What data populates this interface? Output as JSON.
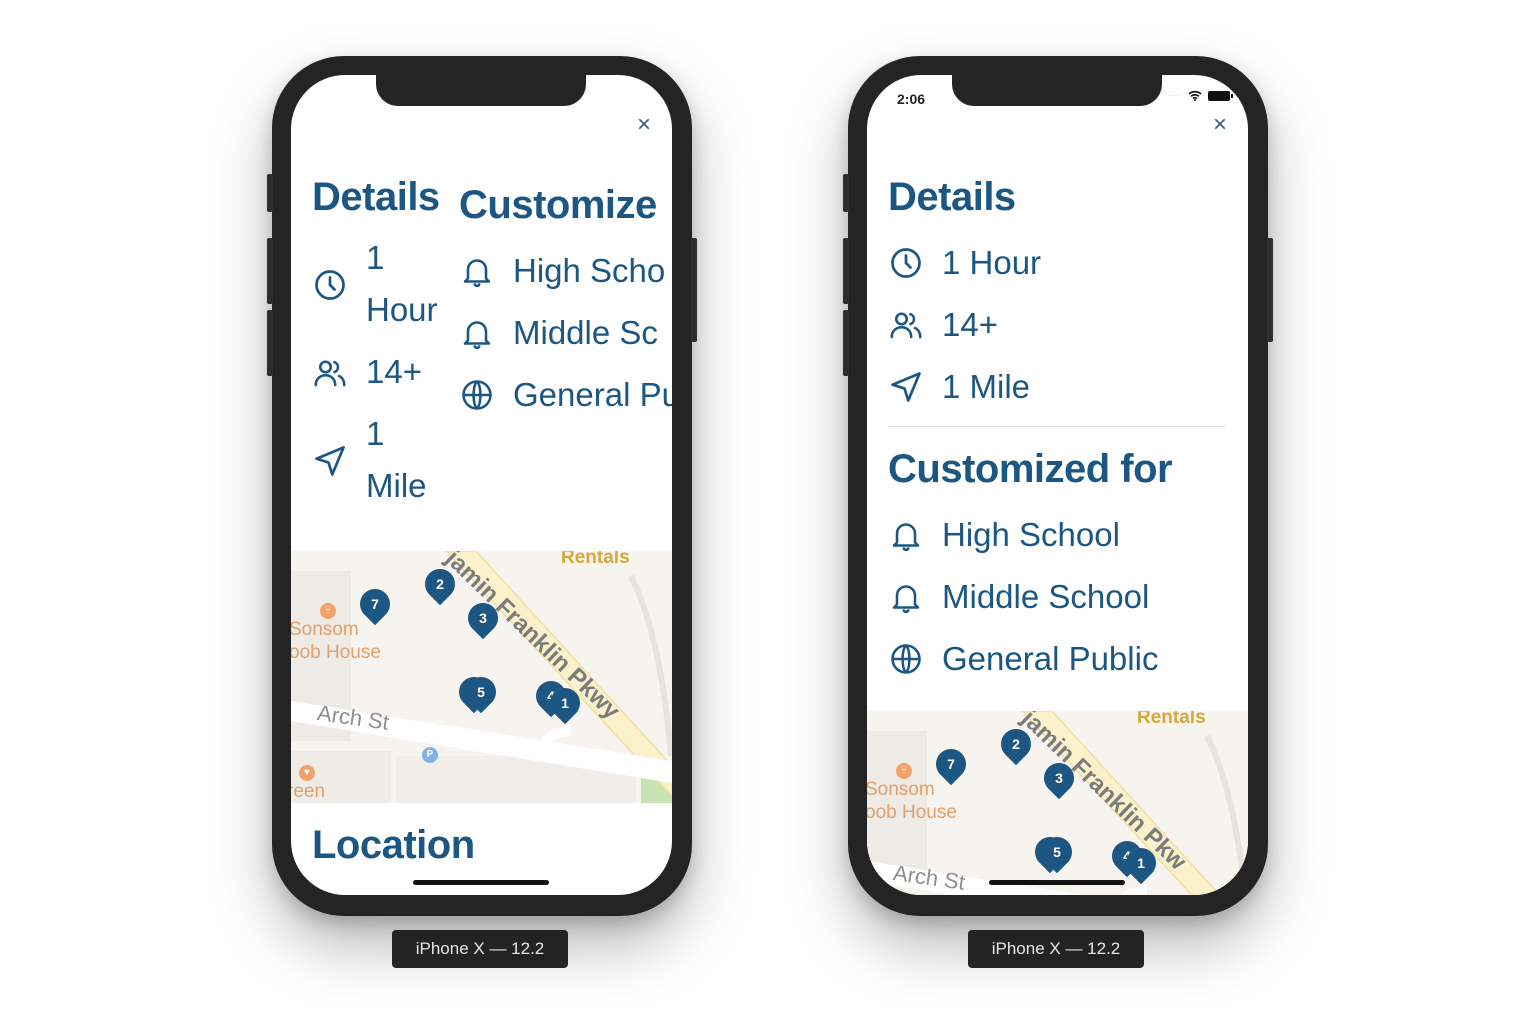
{
  "devices": [
    {
      "label": "iPhone X — 12.2",
      "status_bar": null,
      "close_icon": "×",
      "details": {
        "heading": "Details",
        "items": [
          {
            "icon": "clock-icon",
            "text": "1 Hour",
            "lines": [
              "1",
              "Hour"
            ]
          },
          {
            "icon": "people-icon",
            "text": "14+",
            "lines": [
              "14+"
            ]
          },
          {
            "icon": "location-arrow-icon",
            "text": "1 Mile",
            "lines": [
              "1",
              "Mile"
            ]
          }
        ]
      },
      "customized": {
        "heading": "Customize",
        "items": [
          {
            "icon": "bell-icon",
            "text": "High Scho"
          },
          {
            "icon": "bell-icon",
            "text": "Middle Sc"
          },
          {
            "icon": "globe-icon",
            "text": "General Pu"
          }
        ]
      },
      "map": {
        "labels": {
          "parkway": "jamin Franklin Pkwy",
          "rentals": "Rentals",
          "poi1_line1": "Sonsom",
          "poi1_line2": "oob House",
          "street": "Arch St",
          "poi2": "reen",
          "parking": "P"
        },
        "pins": [
          "7",
          "2",
          "3",
          "5",
          "4",
          "1"
        ]
      },
      "location_heading": "Location"
    },
    {
      "label": "iPhone X — 12.2",
      "status_bar": {
        "time": "2:06",
        "signal": "····"
      },
      "close_icon": "×",
      "details": {
        "heading": "Details",
        "items": [
          {
            "icon": "clock-icon",
            "text": "1 Hour"
          },
          {
            "icon": "people-icon",
            "text": "14+"
          },
          {
            "icon": "location-arrow-icon",
            "text": "1 Mile"
          }
        ]
      },
      "customized": {
        "heading": "Customized for",
        "items": [
          {
            "icon": "bell-icon",
            "text": "High School"
          },
          {
            "icon": "bell-icon",
            "text": "Middle School"
          },
          {
            "icon": "globe-icon",
            "text": "General Public"
          }
        ]
      },
      "map": {
        "labels": {
          "parkway": "jamin Franklin Pkw",
          "rentals": "Rentals",
          "poi1_line1": "Sonsom",
          "poi1_line2": "oob House",
          "street": "Arch St"
        },
        "pins": [
          "7",
          "2",
          "3",
          "5",
          "4",
          "1"
        ]
      }
    }
  ],
  "colors": {
    "accent": "#1b5782",
    "map_bg": "#f7f4ef",
    "poi": "#e2a06b",
    "bezel": "#242424"
  }
}
